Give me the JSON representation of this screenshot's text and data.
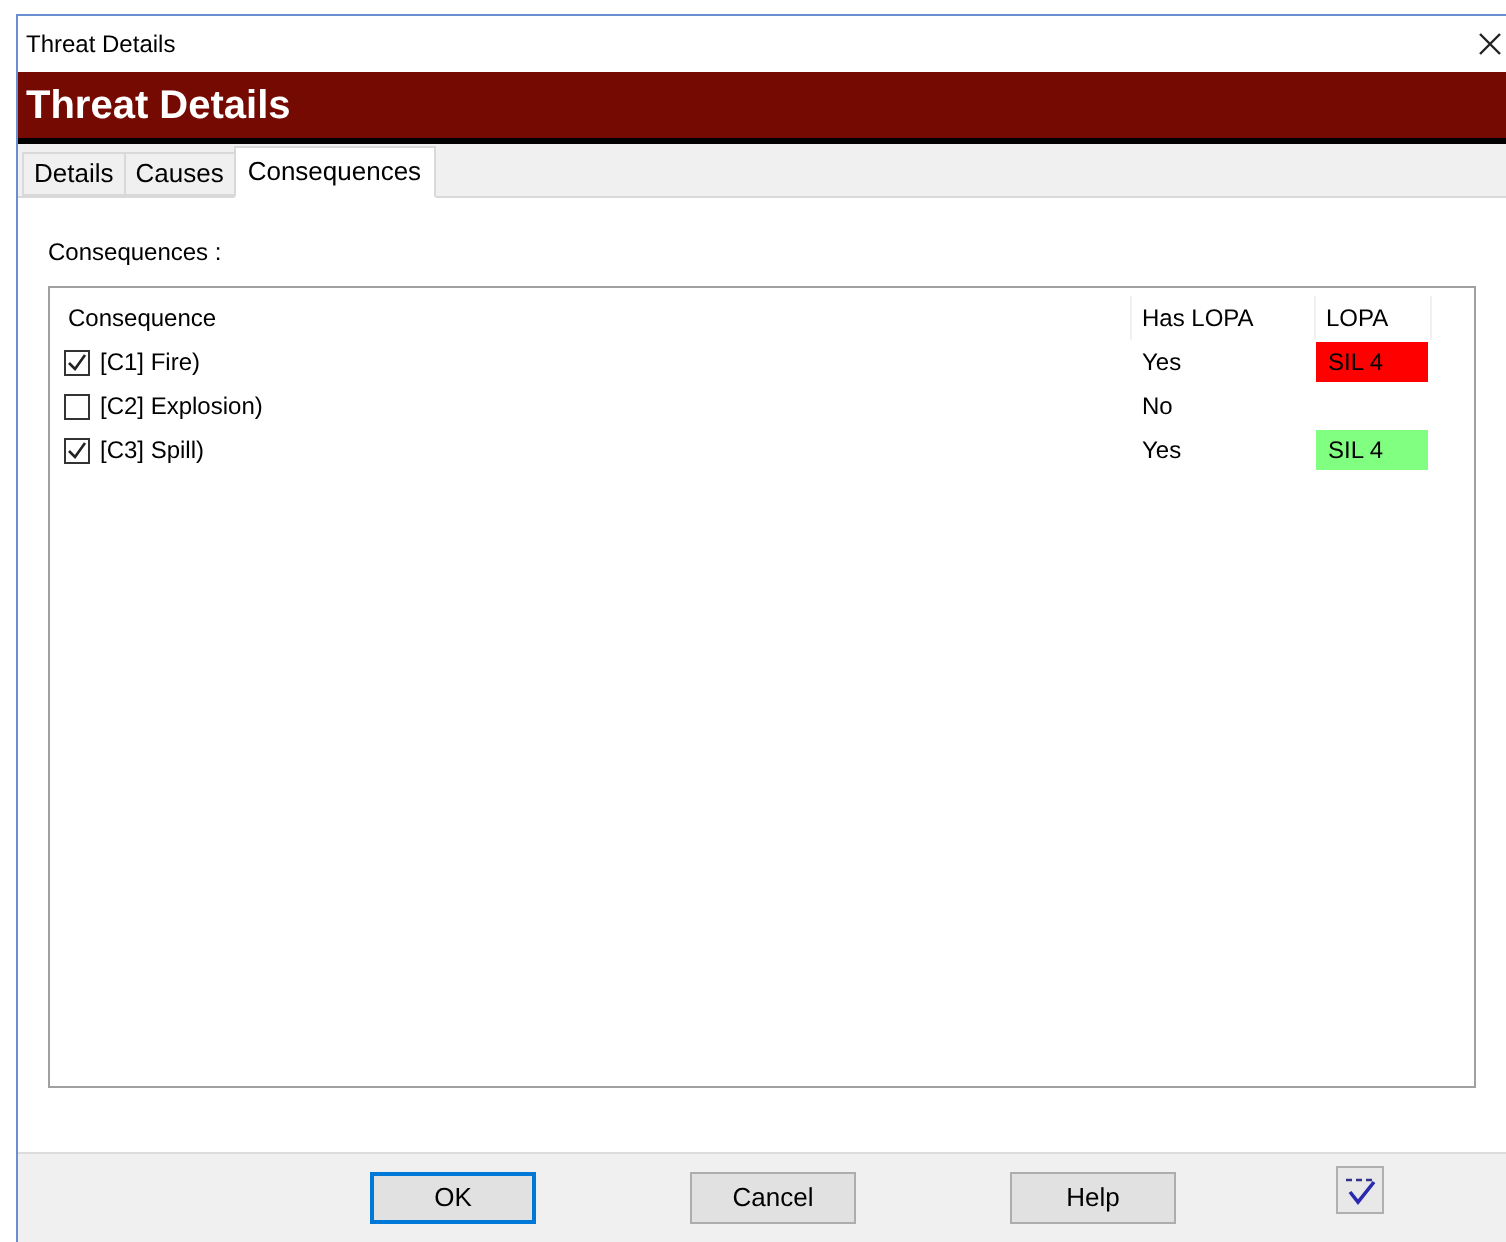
{
  "window": {
    "title": "Threat Details"
  },
  "banner": {
    "title": "Threat Details"
  },
  "tabs": [
    {
      "label": "Details",
      "selected": false
    },
    {
      "label": "Causes",
      "selected": false
    },
    {
      "label": "Consequences",
      "selected": true
    }
  ],
  "section_label": "Consequences :",
  "table": {
    "columns": [
      "Consequence",
      "Has LOPA",
      "LOPA"
    ],
    "rows": [
      {
        "checked": true,
        "consequence": "[C1] Fire)",
        "has_lopa": "Yes",
        "lopa": "SIL 4",
        "color": "#ff0000"
      },
      {
        "checked": false,
        "consequence": "[C2] Explosion)",
        "has_lopa": "No"
      },
      {
        "checked": true,
        "consequence": "[C3] Spill)",
        "has_lopa": "Yes",
        "lopa": "SIL 4",
        "color": "#80ff80"
      }
    ]
  },
  "buttons": [
    {
      "label": "OK",
      "selected": true
    },
    {
      "label": "Cancel",
      "selected": false
    },
    {
      "label": "Help",
      "selected": false
    }
  ]
}
